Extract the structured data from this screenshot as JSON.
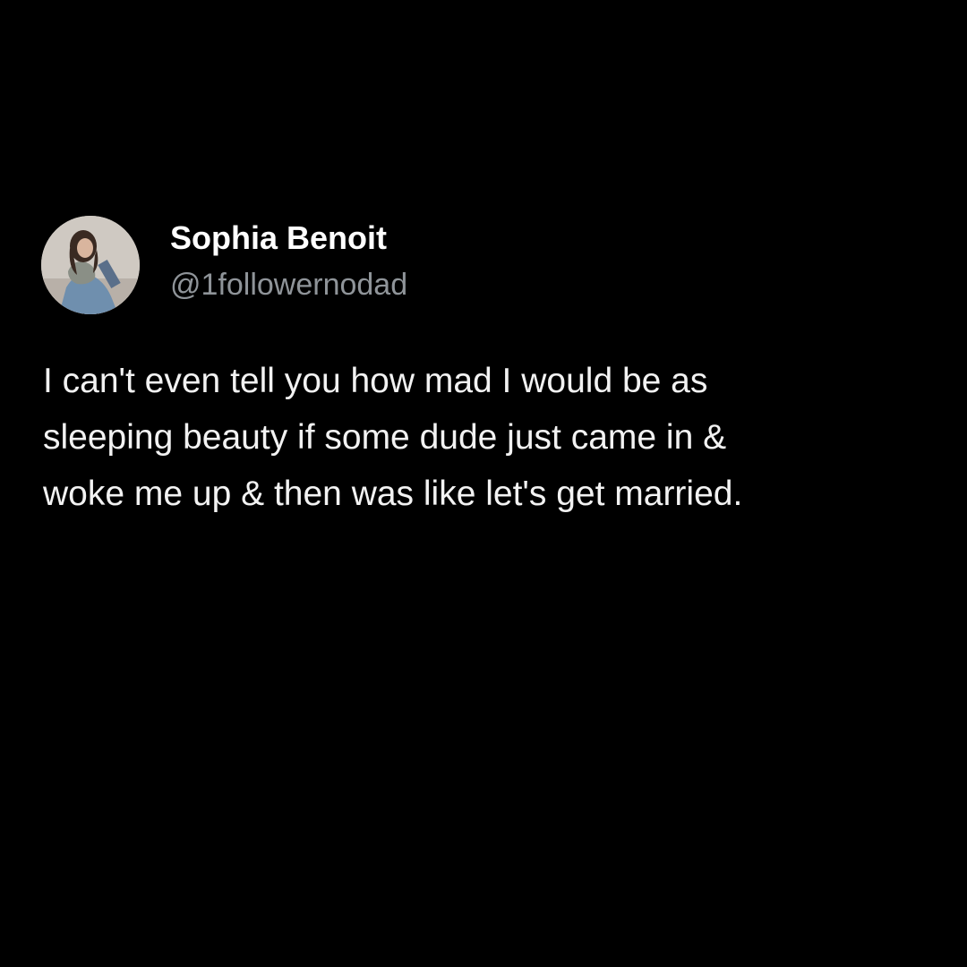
{
  "tweet": {
    "author": {
      "display_name": "Sophia Benoit",
      "handle": "@1followernodad",
      "avatar_icon": "profile-photo"
    },
    "text": "I can't even tell you how mad I would be as\nsleeping beauty if some dude just came in &\nwoke me up & then was like let's get married."
  },
  "colors": {
    "background": "#000000",
    "name": "#ffffff",
    "handle": "#8f9499",
    "body_text": "#f2f2f2"
  }
}
